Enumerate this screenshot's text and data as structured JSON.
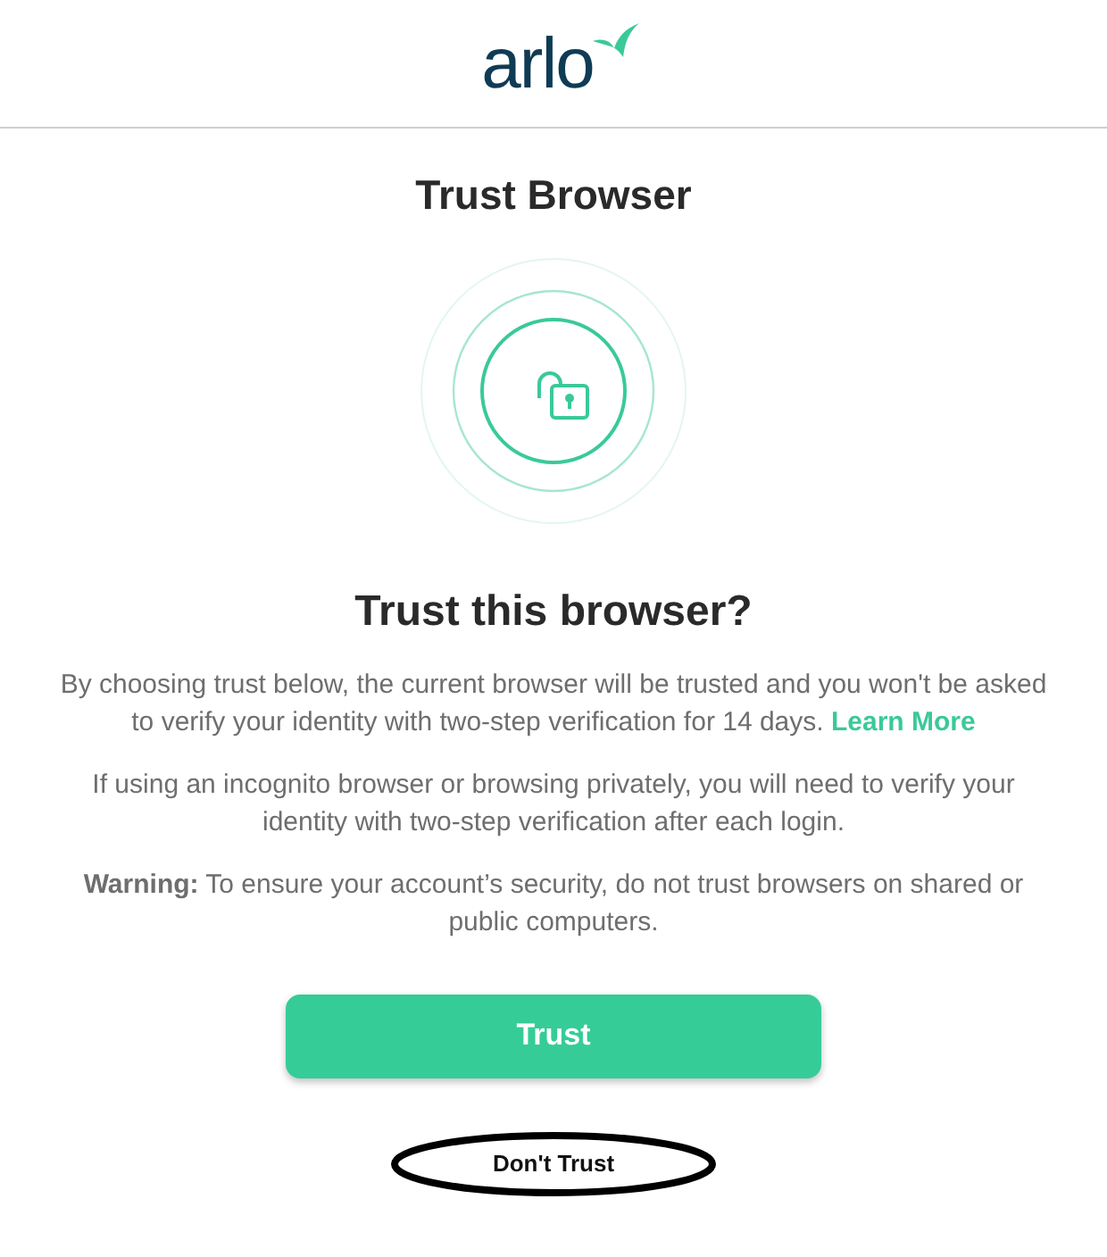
{
  "header": {
    "logo": "arlo"
  },
  "page_title": "Trust Browser",
  "heading": "Trust this browser?",
  "paragraphs": [
    {
      "text": "By choosing trust below, the current browser will be trusted and you won't be asked to verify your identity with two-step verification for 14 days.",
      "link": "Learn More"
    },
    {
      "text": "If using an incognito browser or browsing privately, you will need to verify your identity with two-step verification after each login."
    },
    {
      "text": "**Warning:** To ensure your account’s security, do not trust browsers on shared or public computers."
    }
  ],
  "primary_button": "Trust",
  "secondary_button": "Don't Trust"
}
